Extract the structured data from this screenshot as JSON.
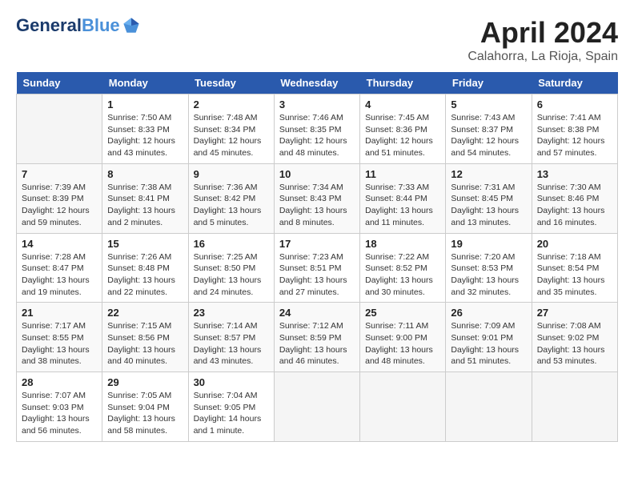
{
  "header": {
    "logo_line1": "General",
    "logo_line2": "Blue",
    "month_title": "April 2024",
    "location": "Calahorra, La Rioja, Spain"
  },
  "days_of_week": [
    "Sunday",
    "Monday",
    "Tuesday",
    "Wednesday",
    "Thursday",
    "Friday",
    "Saturday"
  ],
  "weeks": [
    [
      {
        "num": "",
        "detail": ""
      },
      {
        "num": "1",
        "detail": "Sunrise: 7:50 AM\nSunset: 8:33 PM\nDaylight: 12 hours\nand 43 minutes."
      },
      {
        "num": "2",
        "detail": "Sunrise: 7:48 AM\nSunset: 8:34 PM\nDaylight: 12 hours\nand 45 minutes."
      },
      {
        "num": "3",
        "detail": "Sunrise: 7:46 AM\nSunset: 8:35 PM\nDaylight: 12 hours\nand 48 minutes."
      },
      {
        "num": "4",
        "detail": "Sunrise: 7:45 AM\nSunset: 8:36 PM\nDaylight: 12 hours\nand 51 minutes."
      },
      {
        "num": "5",
        "detail": "Sunrise: 7:43 AM\nSunset: 8:37 PM\nDaylight: 12 hours\nand 54 minutes."
      },
      {
        "num": "6",
        "detail": "Sunrise: 7:41 AM\nSunset: 8:38 PM\nDaylight: 12 hours\nand 57 minutes."
      }
    ],
    [
      {
        "num": "7",
        "detail": "Sunrise: 7:39 AM\nSunset: 8:39 PM\nDaylight: 12 hours\nand 59 minutes."
      },
      {
        "num": "8",
        "detail": "Sunrise: 7:38 AM\nSunset: 8:41 PM\nDaylight: 13 hours\nand 2 minutes."
      },
      {
        "num": "9",
        "detail": "Sunrise: 7:36 AM\nSunset: 8:42 PM\nDaylight: 13 hours\nand 5 minutes."
      },
      {
        "num": "10",
        "detail": "Sunrise: 7:34 AM\nSunset: 8:43 PM\nDaylight: 13 hours\nand 8 minutes."
      },
      {
        "num": "11",
        "detail": "Sunrise: 7:33 AM\nSunset: 8:44 PM\nDaylight: 13 hours\nand 11 minutes."
      },
      {
        "num": "12",
        "detail": "Sunrise: 7:31 AM\nSunset: 8:45 PM\nDaylight: 13 hours\nand 13 minutes."
      },
      {
        "num": "13",
        "detail": "Sunrise: 7:30 AM\nSunset: 8:46 PM\nDaylight: 13 hours\nand 16 minutes."
      }
    ],
    [
      {
        "num": "14",
        "detail": "Sunrise: 7:28 AM\nSunset: 8:47 PM\nDaylight: 13 hours\nand 19 minutes."
      },
      {
        "num": "15",
        "detail": "Sunrise: 7:26 AM\nSunset: 8:48 PM\nDaylight: 13 hours\nand 22 minutes."
      },
      {
        "num": "16",
        "detail": "Sunrise: 7:25 AM\nSunset: 8:50 PM\nDaylight: 13 hours\nand 24 minutes."
      },
      {
        "num": "17",
        "detail": "Sunrise: 7:23 AM\nSunset: 8:51 PM\nDaylight: 13 hours\nand 27 minutes."
      },
      {
        "num": "18",
        "detail": "Sunrise: 7:22 AM\nSunset: 8:52 PM\nDaylight: 13 hours\nand 30 minutes."
      },
      {
        "num": "19",
        "detail": "Sunrise: 7:20 AM\nSunset: 8:53 PM\nDaylight: 13 hours\nand 32 minutes."
      },
      {
        "num": "20",
        "detail": "Sunrise: 7:18 AM\nSunset: 8:54 PM\nDaylight: 13 hours\nand 35 minutes."
      }
    ],
    [
      {
        "num": "21",
        "detail": "Sunrise: 7:17 AM\nSunset: 8:55 PM\nDaylight: 13 hours\nand 38 minutes."
      },
      {
        "num": "22",
        "detail": "Sunrise: 7:15 AM\nSunset: 8:56 PM\nDaylight: 13 hours\nand 40 minutes."
      },
      {
        "num": "23",
        "detail": "Sunrise: 7:14 AM\nSunset: 8:57 PM\nDaylight: 13 hours\nand 43 minutes."
      },
      {
        "num": "24",
        "detail": "Sunrise: 7:12 AM\nSunset: 8:59 PM\nDaylight: 13 hours\nand 46 minutes."
      },
      {
        "num": "25",
        "detail": "Sunrise: 7:11 AM\nSunset: 9:00 PM\nDaylight: 13 hours\nand 48 minutes."
      },
      {
        "num": "26",
        "detail": "Sunrise: 7:09 AM\nSunset: 9:01 PM\nDaylight: 13 hours\nand 51 minutes."
      },
      {
        "num": "27",
        "detail": "Sunrise: 7:08 AM\nSunset: 9:02 PM\nDaylight: 13 hours\nand 53 minutes."
      }
    ],
    [
      {
        "num": "28",
        "detail": "Sunrise: 7:07 AM\nSunset: 9:03 PM\nDaylight: 13 hours\nand 56 minutes."
      },
      {
        "num": "29",
        "detail": "Sunrise: 7:05 AM\nSunset: 9:04 PM\nDaylight: 13 hours\nand 58 minutes."
      },
      {
        "num": "30",
        "detail": "Sunrise: 7:04 AM\nSunset: 9:05 PM\nDaylight: 14 hours\nand 1 minute."
      },
      {
        "num": "",
        "detail": ""
      },
      {
        "num": "",
        "detail": ""
      },
      {
        "num": "",
        "detail": ""
      },
      {
        "num": "",
        "detail": ""
      }
    ]
  ]
}
